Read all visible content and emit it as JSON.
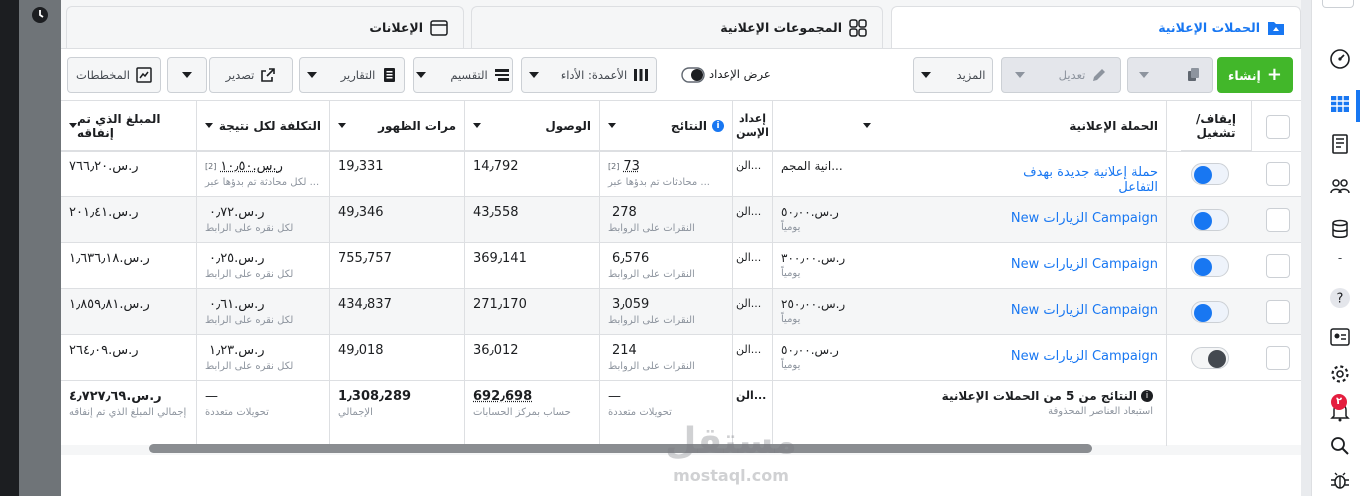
{
  "tabs": {
    "campaigns": "الحملات الإعلانية",
    "adsets": "المجموعات الإعلانية",
    "ads": "الإعلانات"
  },
  "toolbar": {
    "create": "إنشاء",
    "edit": "تعديل",
    "more": "المزيد",
    "delivery": "عرض الإعداد",
    "columns": "الأعمدة: الأداء",
    "breakdown": "التقسيم",
    "reports": "التقارير",
    "export": "تصدير",
    "charts": "المخططات"
  },
  "headers": {
    "toggle": "إيقاف/ تشغيل",
    "campaign": "الحملة الإعلانية",
    "budget": "",
    "delivery": "إعداد الإسن",
    "results": "النتائج",
    "reach": "الوصول",
    "impressions": "مرات الظهور",
    "cost": "التكلفة لكل نتيجة",
    "spent": "المبلغ الذي تم إنفاقه"
  },
  "rows": [
    {
      "on": true,
      "name": "حملة إعلانية جديدة بهدف التفاعل",
      "budget": "انية المجم...",
      "budget_sub": "",
      "delivery": "الن...",
      "results": "73",
      "results_note": "[2]",
      "results_sub": "محادثات تم بدؤها عبر ...",
      "reach": "14٫792",
      "impressions": "19٫331",
      "cost": "ر.س.١٠٫٥٠",
      "cost_note": "[2]",
      "cost_sub": "لكل محادثة تم بدؤها عبر ...",
      "spent": "ر.س.٧٦٦٫٢٠"
    },
    {
      "on": true,
      "name": "Campaign الزيارات New",
      "budget": "ر.س.٥٠٫٠٠",
      "budget_sub": "يومياً",
      "delivery": "الن...",
      "results": "278",
      "results_note": "",
      "results_sub": "النقرات على الروابط",
      "reach": "43٫558",
      "impressions": "49٫346",
      "cost": "ر.س.٠٫٧٢",
      "cost_note": "",
      "cost_sub": "لكل نقره على الرابط",
      "spent": "ر.س.٢٠١٫٤١"
    },
    {
      "on": true,
      "name": "Campaign الزيارات New",
      "budget": "ر.س.٣٠٠٫٠٠",
      "budget_sub": "يومياً",
      "delivery": "الن...",
      "results": "6٫576",
      "results_note": "",
      "results_sub": "النقرات على الروابط",
      "reach": "369٫141",
      "impressions": "755٫757",
      "cost": "ر.س.٠٫٢٥",
      "cost_note": "",
      "cost_sub": "لكل نقره على الرابط",
      "spent": "ر.س.١٫٦٣٦٫١٨"
    },
    {
      "on": true,
      "name": "Campaign الزيارات New",
      "budget": "ر.س.٢٥٠٫٠٠",
      "budget_sub": "يومياً",
      "delivery": "الن...",
      "results": "3٫059",
      "results_note": "",
      "results_sub": "النقرات على الروابط",
      "reach": "271٫170",
      "impressions": "434٫837",
      "cost": "ر.س.٠٫٦١",
      "cost_note": "",
      "cost_sub": "لكل نقره على الرابط",
      "spent": "ر.س.١٫٨٥٩٫٨١"
    },
    {
      "on": false,
      "name": "Campaign الزيارات New",
      "budget": "ر.س.٥٠٫٠٠",
      "budget_sub": "يومياً",
      "delivery": "الن...",
      "results": "214",
      "results_note": "",
      "results_sub": "النقرات على الروابط",
      "reach": "36٫012",
      "impressions": "49٫018",
      "cost": "ر.س.١٫٢٣",
      "cost_note": "",
      "cost_sub": "لكل نقره على الرابط",
      "spent": "ر.س.٢٦٤٫٠٩"
    }
  ],
  "totals": {
    "label": "النتائج من 5 من الحملات الإعلانية",
    "label_sub": "استبعاد العناصر المحذوفة",
    "delivery": "الن...",
    "results": "—",
    "results_sub": "تحويلات متعددة",
    "reach": "692٫698",
    "reach_sub": "حساب بمركز الحسابات",
    "impressions": "1٫308٫289",
    "impressions_sub": "الإجمالي",
    "cost": "—",
    "cost_sub": "تحويلات متعددة",
    "spent": "ر.س.٤٫٧٢٧٫٦٩",
    "spent_sub": "إجمالي المبلغ الذي تم إنفاقه"
  },
  "sidebar": {
    "notif_count": "٢"
  },
  "watermark": {
    "arabic": "مستقل",
    "latin": "mostaql.com"
  }
}
